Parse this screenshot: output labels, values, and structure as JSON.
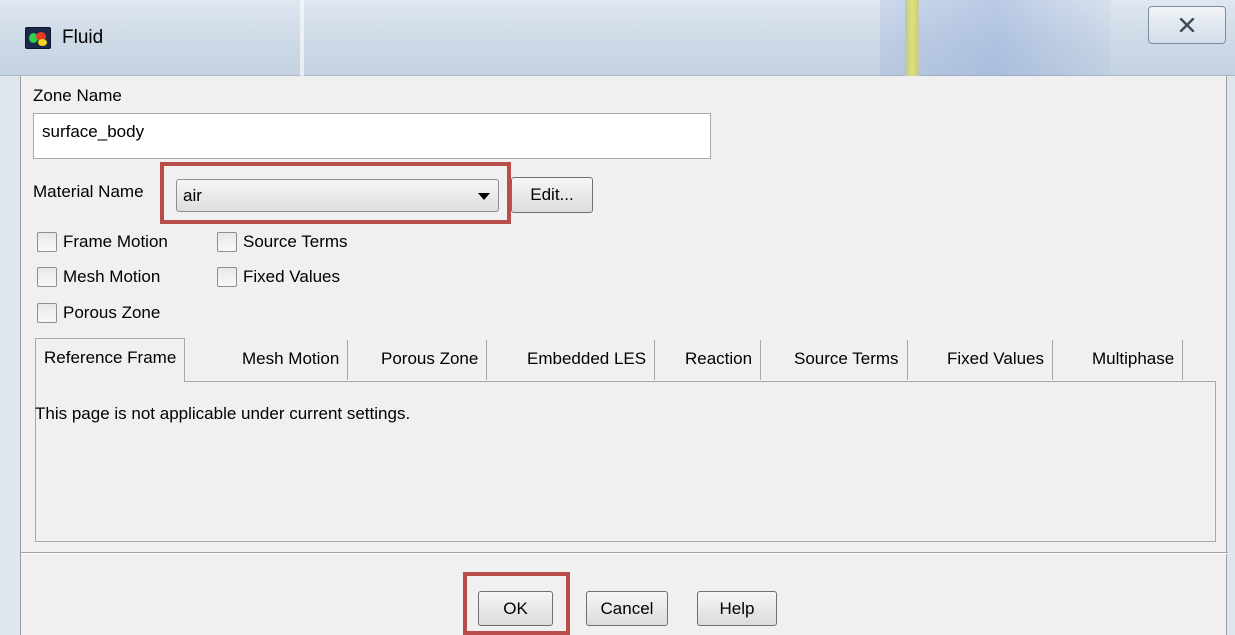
{
  "window": {
    "title": "Fluid",
    "close_glyph": "X"
  },
  "zone": {
    "label": "Zone Name",
    "value": "surface_body"
  },
  "material": {
    "label": "Material Name",
    "selected": "air",
    "edit_label": "Edit..."
  },
  "checkboxes": {
    "frame_motion": "Frame Motion",
    "source_terms": "Source Terms",
    "mesh_motion": "Mesh Motion",
    "fixed_values": "Fixed Values",
    "porous_zone": "Porous Zone"
  },
  "tabs": [
    {
      "label": "Reference Frame",
      "active": true
    },
    {
      "label": "Mesh Motion"
    },
    {
      "label": "Porous Zone"
    },
    {
      "label": "Embedded LES"
    },
    {
      "label": "Reaction"
    },
    {
      "label": "Source Terms"
    },
    {
      "label": "Fixed Values"
    },
    {
      "label": "Multiphase"
    }
  ],
  "panel": {
    "message": "This page is not applicable under current settings."
  },
  "buttons": {
    "ok": "OK",
    "cancel": "Cancel",
    "help": "Help"
  },
  "colors": {
    "highlight": "#b94d4a",
    "dialog_bg": "#f0f0f0"
  }
}
